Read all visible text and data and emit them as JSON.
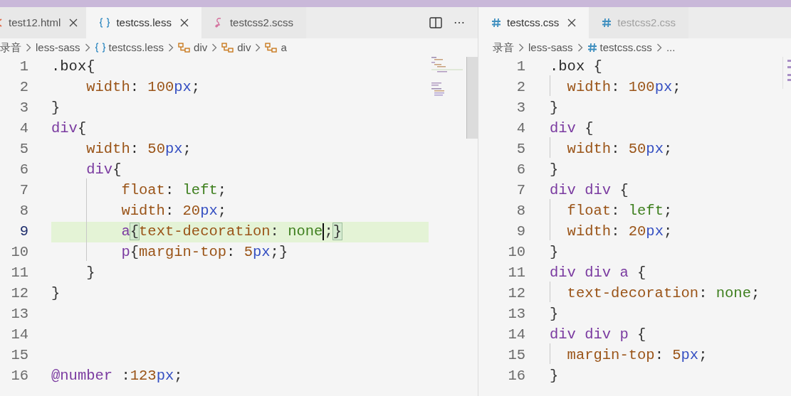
{
  "editors": [
    {
      "kind": "less",
      "tabs": [
        {
          "label": "test12.html",
          "kind": "html",
          "selected": false,
          "closable": true,
          "dimmed": false
        },
        {
          "label": "testcss.less",
          "kind": "less",
          "selected": true,
          "closable": true,
          "dimmed": false
        },
        {
          "label": "testcss2.scss",
          "kind": "scss",
          "selected": false,
          "closable": false,
          "dimmed": false
        }
      ],
      "actions": [
        "⋯"
      ],
      "breadcrumbs": [
        {
          "label": "录音",
          "kind": "folder"
        },
        {
          "label": "less-sass",
          "kind": "folder"
        },
        {
          "label": "testcss.less",
          "kind": "less"
        },
        {
          "label": "div",
          "kind": "symbol"
        },
        {
          "label": "div",
          "kind": "symbol"
        },
        {
          "label": "a",
          "kind": "symbol"
        }
      ],
      "lines": [
        {
          "number": "1",
          "current": false,
          "guide": false,
          "code": [
            {
              "text": ".box",
              "kind": "class"
            },
            {
              "text": "{",
              "kind": "punct"
            }
          ]
        },
        {
          "number": "2",
          "current": false,
          "guide": false,
          "code": [
            {
              "text": "    width",
              "kind": "property"
            },
            {
              "text": ": ",
              "kind": "punct"
            },
            {
              "text": "100",
              "kind": "number"
            },
            {
              "text": "px",
              "kind": "unit"
            },
            {
              "text": ";",
              "kind": "punct"
            }
          ]
        },
        {
          "number": "3",
          "current": false,
          "guide": false,
          "code": [
            {
              "text": "}",
              "kind": "punct"
            }
          ]
        },
        {
          "number": "4",
          "current": false,
          "guide": false,
          "code": [
            {
              "text": "div",
              "kind": "tag"
            },
            {
              "text": "{",
              "kind": "punct"
            }
          ]
        },
        {
          "number": "5",
          "current": false,
          "guide": false,
          "code": [
            {
              "text": "    width",
              "kind": "property"
            },
            {
              "text": ": ",
              "kind": "punct"
            },
            {
              "text": "50",
              "kind": "number"
            },
            {
              "text": "px",
              "kind": "unit"
            },
            {
              "text": ";",
              "kind": "punct"
            }
          ]
        },
        {
          "number": "6",
          "current": false,
          "guide": false,
          "code": [
            {
              "text": "    div",
              "kind": "tag"
            },
            {
              "text": "{",
              "kind": "punct"
            }
          ]
        },
        {
          "number": "7",
          "current": false,
          "guide": true,
          "code": [
            {
              "text": "        float",
              "kind": "property"
            },
            {
              "text": ": ",
              "kind": "punct"
            },
            {
              "text": "left",
              "kind": "keyword"
            },
            {
              "text": ";",
              "kind": "punct"
            }
          ]
        },
        {
          "number": "8",
          "current": false,
          "guide": true,
          "code": [
            {
              "text": "        width",
              "kind": "property"
            },
            {
              "text": ": ",
              "kind": "punct"
            },
            {
              "text": "20",
              "kind": "number"
            },
            {
              "text": "px",
              "kind": "unit"
            },
            {
              "text": ";",
              "kind": "punct"
            }
          ]
        },
        {
          "number": "9",
          "current": true,
          "guide": true,
          "code": [
            {
              "text": "        a",
              "kind": "tag"
            },
            {
              "text": "{",
              "kind": "bracket"
            },
            {
              "text": "text-decoration",
              "kind": "property"
            },
            {
              "text": ": ",
              "kind": "punct"
            },
            {
              "text": "none",
              "kind": "keyword",
              "cursor": true
            },
            {
              "text": ";",
              "kind": "punct"
            },
            {
              "text": "}",
              "kind": "bracket"
            }
          ]
        },
        {
          "number": "10",
          "current": false,
          "guide": true,
          "code": [
            {
              "text": "        p",
              "kind": "tag"
            },
            {
              "text": "{",
              "kind": "punct"
            },
            {
              "text": "margin-top",
              "kind": "property"
            },
            {
              "text": ": ",
              "kind": "punct"
            },
            {
              "text": "5",
              "kind": "number"
            },
            {
              "text": "px",
              "kind": "unit"
            },
            {
              "text": ";}",
              "kind": "punct"
            }
          ]
        },
        {
          "number": "11",
          "current": false,
          "guide": false,
          "code": [
            {
              "text": "    }",
              "kind": "punct"
            }
          ]
        },
        {
          "number": "12",
          "current": false,
          "guide": false,
          "code": [
            {
              "text": "}",
              "kind": "punct"
            }
          ]
        },
        {
          "number": "13",
          "current": false,
          "guide": false
        },
        {
          "number": "14",
          "current": false,
          "guide": false
        },
        {
          "number": "15",
          "current": false,
          "guide": false
        },
        {
          "number": "16",
          "current": false,
          "guide": false,
          "code": [
            {
              "text": "@number",
              "kind": "variable"
            },
            {
              "text": " :",
              "kind": "punct"
            },
            {
              "text": "123",
              "kind": "number"
            },
            {
              "text": "px",
              "kind": "unit"
            },
            {
              "text": ";",
              "kind": "punct"
            }
          ]
        }
      ]
    },
    {
      "kind": "css",
      "tabs": [
        {
          "label": "testcss.css",
          "kind": "css",
          "selected": true,
          "closable": true,
          "dimmed": false
        },
        {
          "label": "testcss2.css",
          "kind": "css",
          "selected": false,
          "closable": false,
          "dimmed": true
        }
      ],
      "breadcrumbs": [
        {
          "label": "录音",
          "kind": "folder"
        },
        {
          "label": "less-sass",
          "kind": "folder"
        },
        {
          "label": "testcss.css",
          "kind": "css"
        },
        {
          "label": "...",
          "kind": "more"
        }
      ],
      "lines": [
        {
          "number": "1",
          "current": false,
          "guide": false,
          "code": [
            {
              "text": ".box",
              "kind": "class"
            },
            {
              "text": " {",
              "kind": "punct"
            }
          ]
        },
        {
          "number": "2",
          "current": false,
          "guide": true,
          "code": [
            {
              "text": "  width",
              "kind": "property"
            },
            {
              "text": ": ",
              "kind": "punct"
            },
            {
              "text": "100",
              "kind": "number"
            },
            {
              "text": "px",
              "kind": "unit"
            },
            {
              "text": ";",
              "kind": "punct"
            }
          ]
        },
        {
          "number": "3",
          "current": false,
          "guide": false,
          "code": [
            {
              "text": "}",
              "kind": "punct"
            }
          ]
        },
        {
          "number": "4",
          "current": false,
          "guide": false,
          "code": [
            {
              "text": "div",
              "kind": "tag"
            },
            {
              "text": " {",
              "kind": "punct"
            }
          ]
        },
        {
          "number": "5",
          "current": false,
          "guide": true,
          "code": [
            {
              "text": "  width",
              "kind": "property"
            },
            {
              "text": ": ",
              "kind": "punct"
            },
            {
              "text": "50",
              "kind": "number"
            },
            {
              "text": "px",
              "kind": "unit"
            },
            {
              "text": ";",
              "kind": "punct"
            }
          ]
        },
        {
          "number": "6",
          "current": false,
          "guide": false,
          "code": [
            {
              "text": "}",
              "kind": "punct"
            }
          ]
        },
        {
          "number": "7",
          "current": false,
          "guide": false,
          "code": [
            {
              "text": "div div",
              "kind": "tag"
            },
            {
              "text": " {",
              "kind": "punct"
            }
          ]
        },
        {
          "number": "8",
          "current": false,
          "guide": true,
          "code": [
            {
              "text": "  float",
              "kind": "property"
            },
            {
              "text": ": ",
              "kind": "punct"
            },
            {
              "text": "left",
              "kind": "keyword"
            },
            {
              "text": ";",
              "kind": "punct"
            }
          ]
        },
        {
          "number": "9",
          "current": false,
          "guide": true,
          "code": [
            {
              "text": "  width",
              "kind": "property"
            },
            {
              "text": ": ",
              "kind": "punct"
            },
            {
              "text": "20",
              "kind": "number"
            },
            {
              "text": "px",
              "kind": "unit"
            },
            {
              "text": ";",
              "kind": "punct"
            }
          ]
        },
        {
          "number": "10",
          "current": false,
          "guide": false,
          "code": [
            {
              "text": "}",
              "kind": "punct"
            }
          ]
        },
        {
          "number": "11",
          "current": false,
          "guide": false,
          "code": [
            {
              "text": "div div a",
              "kind": "tag"
            },
            {
              "text": " {",
              "kind": "punct"
            }
          ]
        },
        {
          "number": "12",
          "current": false,
          "guide": true,
          "code": [
            {
              "text": "  text-decoration",
              "kind": "property"
            },
            {
              "text": ": ",
              "kind": "punct"
            },
            {
              "text": "none",
              "kind": "keyword"
            },
            {
              "text": ";",
              "kind": "punct"
            }
          ]
        },
        {
          "number": "13",
          "current": false,
          "guide": false,
          "code": [
            {
              "text": "}",
              "kind": "punct"
            }
          ]
        },
        {
          "number": "14",
          "current": false,
          "guide": false,
          "code": [
            {
              "text": "div div p",
              "kind": "tag"
            },
            {
              "text": " {",
              "kind": "punct"
            }
          ]
        },
        {
          "number": "15",
          "current": false,
          "guide": true,
          "code": [
            {
              "text": "  margin-top",
              "kind": "property"
            },
            {
              "text": ": ",
              "kind": "punct"
            },
            {
              "text": "5",
              "kind": "number"
            },
            {
              "text": "px",
              "kind": "unit"
            },
            {
              "text": ";",
              "kind": "punct"
            }
          ]
        },
        {
          "number": "16",
          "current": false,
          "guide": false,
          "code": [
            {
              "text": "}",
              "kind": "punct"
            }
          ]
        }
      ]
    }
  ]
}
